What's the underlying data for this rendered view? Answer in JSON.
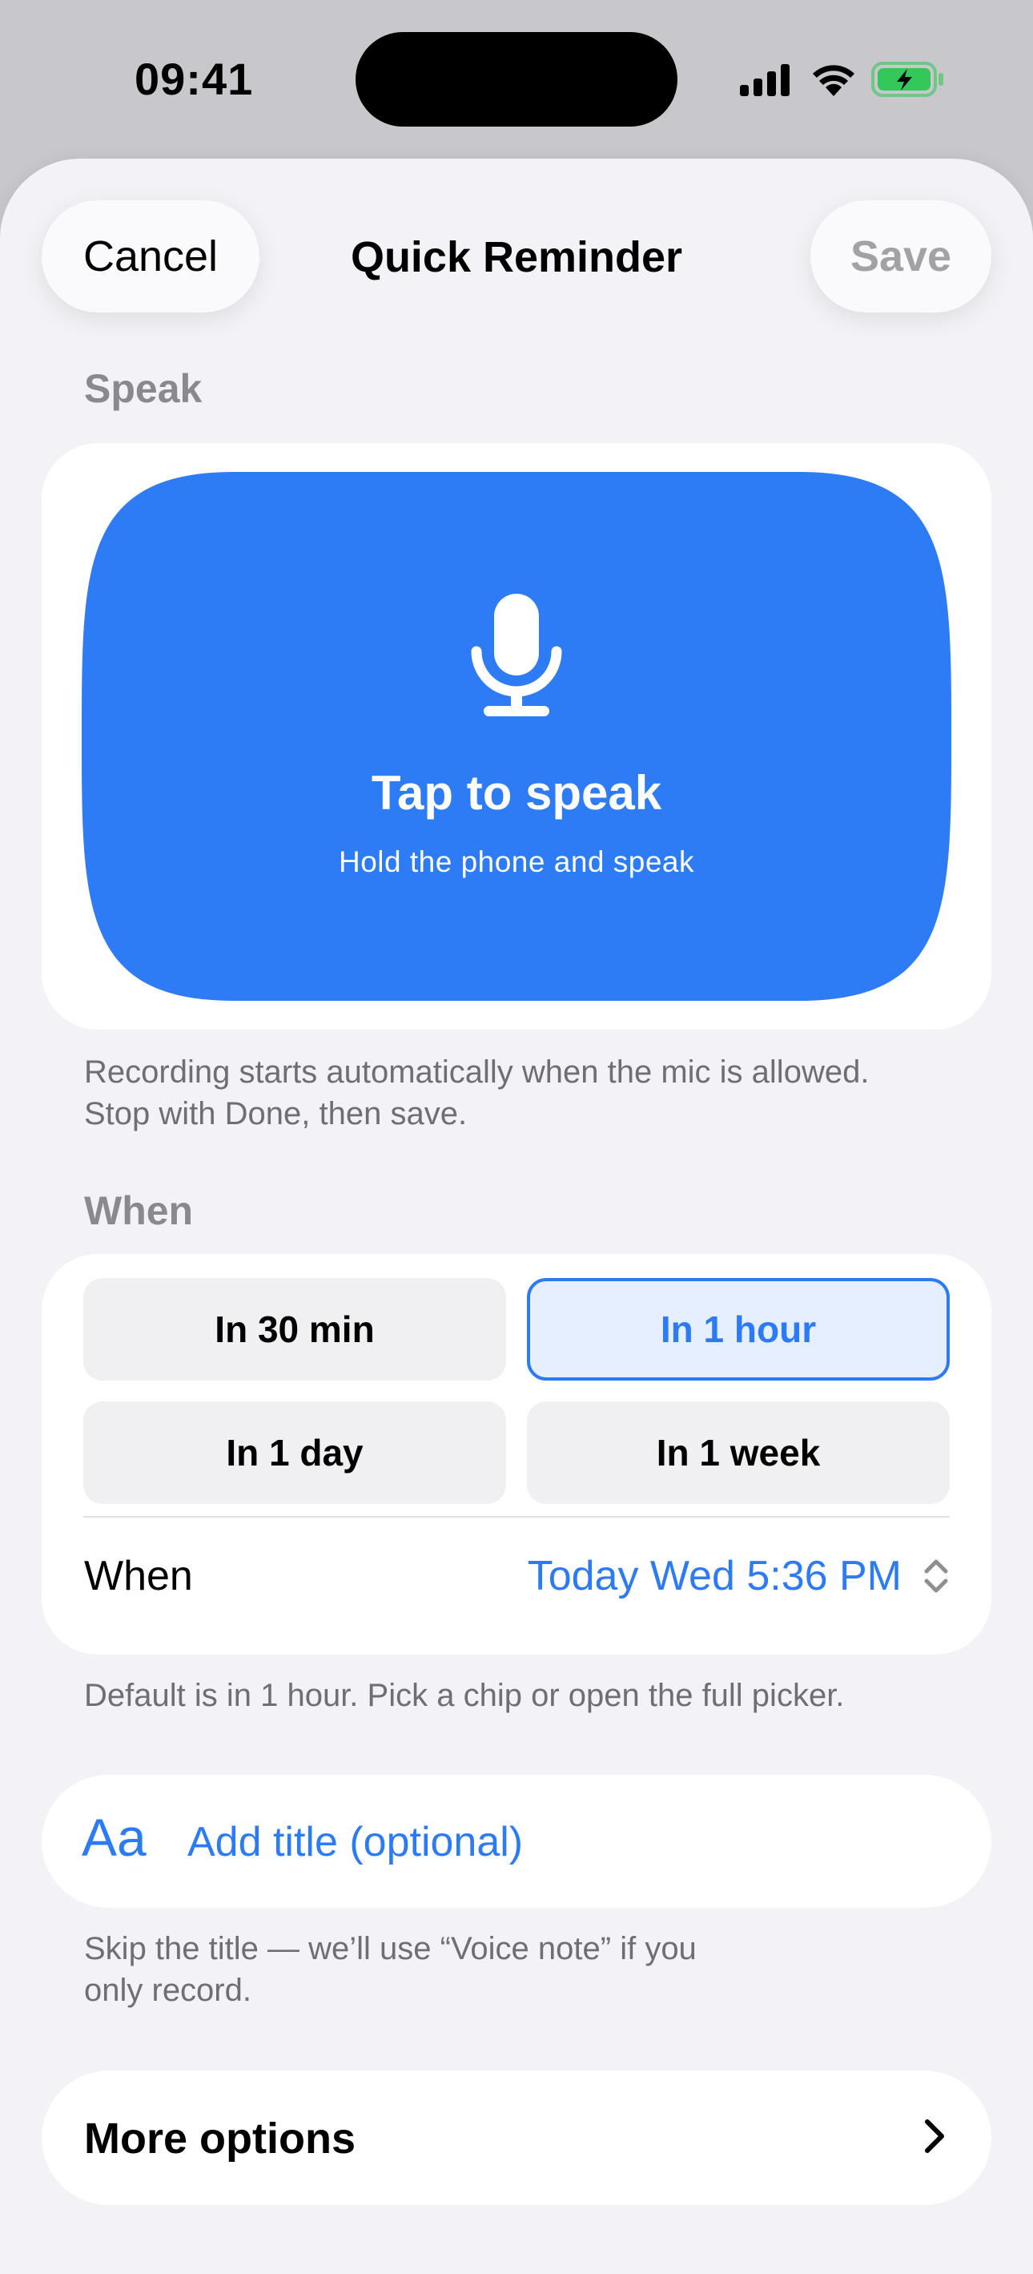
{
  "status_bar": {
    "time": "09:41",
    "icons": [
      "cellular-signal-icon",
      "wifi-icon",
      "battery-charging-icon"
    ],
    "battery_color": "#34c759"
  },
  "nav": {
    "cancel_label": "Cancel",
    "title": "Quick Reminder",
    "save_label": "Save"
  },
  "speak": {
    "section_label": "Speak",
    "icon": "microphone-icon",
    "button_title": "Tap to speak",
    "button_subtitle": "Hold the phone and speak",
    "button_color": "#2d7cf6",
    "footnote_line1": "Recording starts automatically when the mic is allowed.",
    "footnote_line2": "Stop with Done, then save."
  },
  "when": {
    "section_label": "When",
    "chips": [
      {
        "label": "In 30 min",
        "selected": false
      },
      {
        "label": "In 1 hour",
        "selected": true
      },
      {
        "label": "In 1 day",
        "selected": false
      },
      {
        "label": "In 1 week",
        "selected": false
      }
    ],
    "row_label": "When",
    "row_value": "Today Wed 5:36 PM",
    "row_icon": "chevron-up-down-icon",
    "footnote": "Default is in 1 hour. Pick a chip or open the full picker."
  },
  "title_field": {
    "icon_text": "Aa",
    "placeholder": "Add title (optional)",
    "footnote_line1": "Skip the title — we’ll use “Voice note” if you",
    "footnote_line2": "only record."
  },
  "more_options": {
    "label": "More options",
    "icon": "chevron-right-icon"
  },
  "colors": {
    "accent": "#2c7bf6",
    "background": "#f2f2f7",
    "secondary_text": "#6e6e73"
  }
}
